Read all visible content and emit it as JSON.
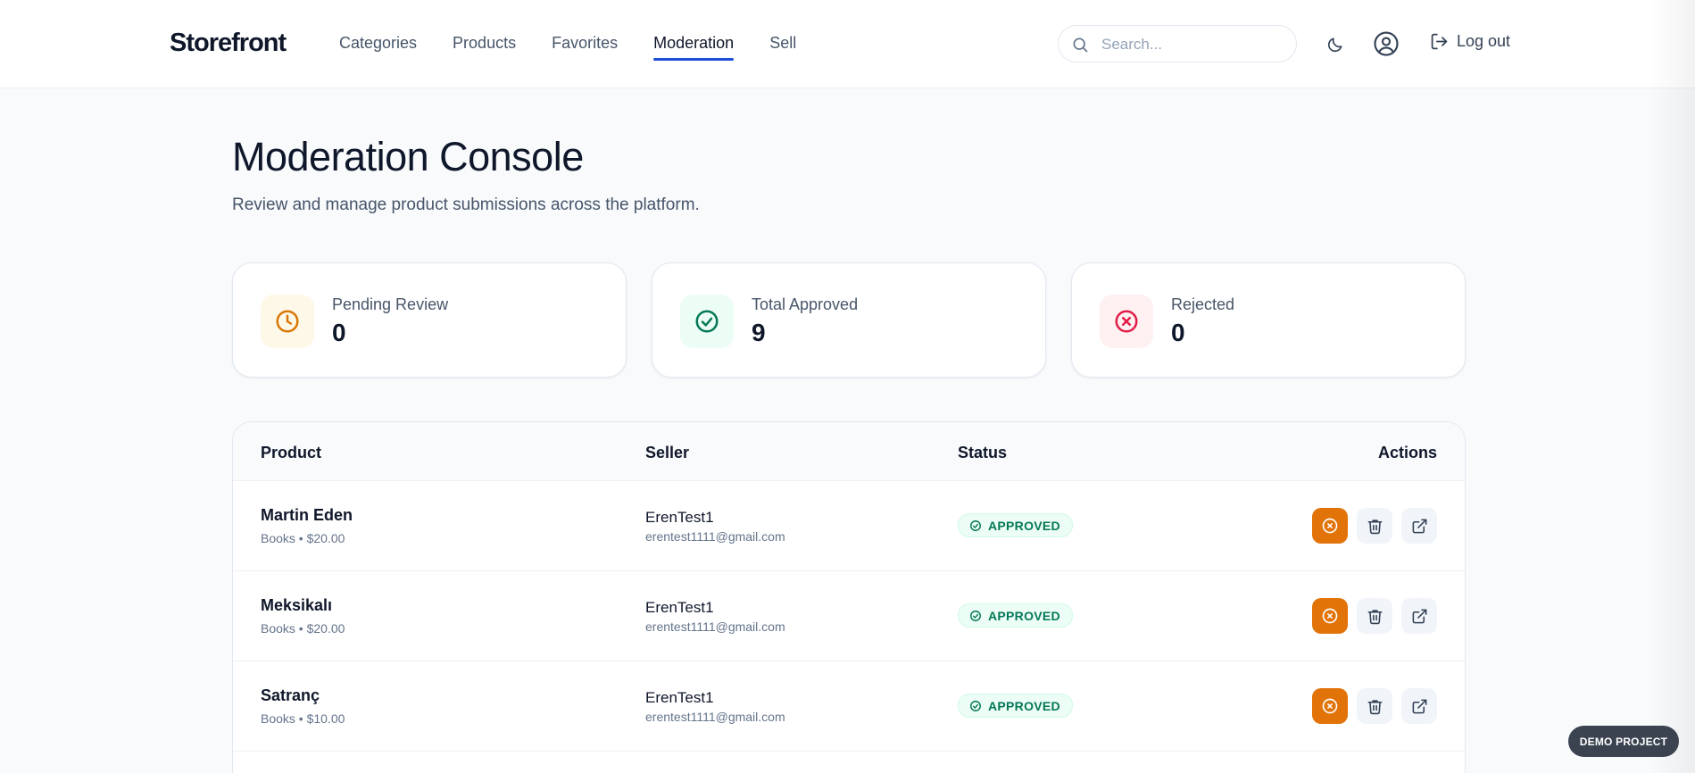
{
  "header": {
    "brand": "Storefront",
    "nav": [
      "Categories",
      "Products",
      "Favorites",
      "Moderation",
      "Sell"
    ],
    "active_nav": "Moderation",
    "search_placeholder": "Search...",
    "logout_label": "Log out"
  },
  "page": {
    "title": "Moderation Console",
    "subtitle": "Review and manage product submissions across the platform."
  },
  "stats": [
    {
      "label": "Pending Review",
      "value": "0",
      "icon": "clock-icon",
      "color": "#d97706",
      "bg": "#fef8e8"
    },
    {
      "label": "Total Approved",
      "value": "9",
      "icon": "check-circle-icon",
      "color": "#047857",
      "bg": "#ecfdf5"
    },
    {
      "label": "Rejected",
      "value": "0",
      "icon": "x-circle-icon",
      "color": "#e11d48",
      "bg": "#fff1f2"
    }
  ],
  "table": {
    "headers": {
      "product": "Product",
      "seller": "Seller",
      "status": "Status",
      "actions": "Actions"
    },
    "rows": [
      {
        "name": "Martin Eden",
        "meta": "Books • $20.00",
        "seller": "ErenTest1",
        "email": "erentest1111@gmail.com",
        "status": "APPROVED"
      },
      {
        "name": "Meksikalı",
        "meta": "Books • $20.00",
        "seller": "ErenTest1",
        "email": "erentest1111@gmail.com",
        "status": "APPROVED"
      },
      {
        "name": "Satranç",
        "meta": "Books • $10.00",
        "seller": "ErenTest1",
        "email": "erentest1111@gmail.com",
        "status": "APPROVED"
      }
    ]
  },
  "demo_badge": "DEMO PROJECT",
  "colors": {
    "accent": "#1d4ed8",
    "reject_button": "#e27308",
    "approved": "#047857"
  }
}
